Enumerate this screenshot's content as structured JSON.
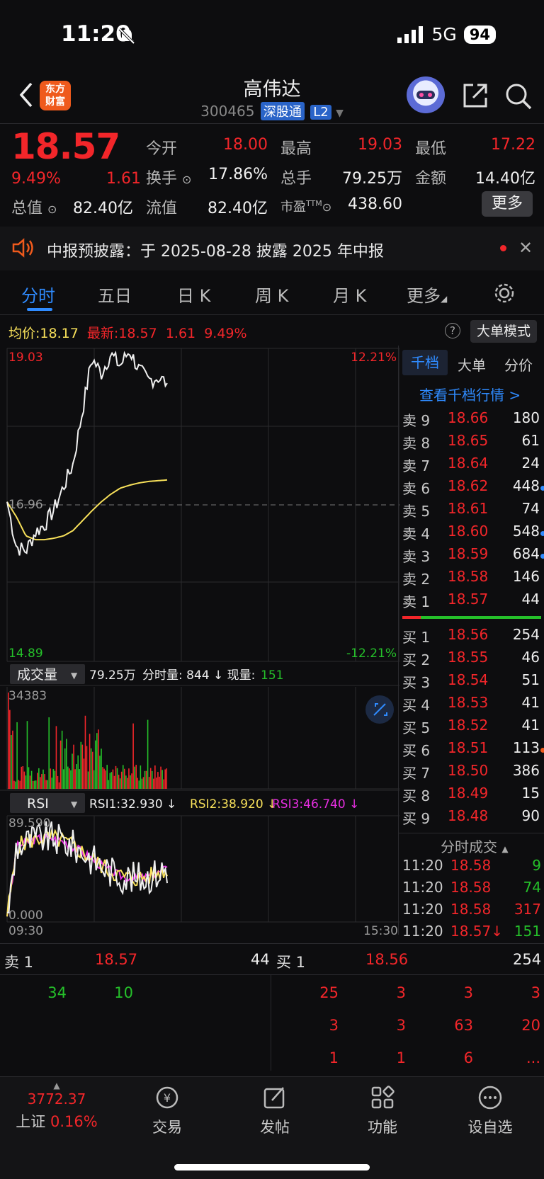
{
  "status": {
    "time": "11:20",
    "signal": "5G",
    "battery": "94"
  },
  "header": {
    "logo_line1": "东方",
    "logo_line2": "财富",
    "name": "高伟达",
    "code": "300465",
    "tag_connect": "深股通",
    "tag_level": "L2"
  },
  "quote": {
    "price": "18.57",
    "pct": "9.49%",
    "change": "1.61",
    "open_label": "今开",
    "open": "18.00",
    "high_label": "最高",
    "high": "19.03",
    "low_label": "最低",
    "low": "17.22",
    "turnover_label": "换手",
    "turnover": "17.86%",
    "total_hands_label": "总手",
    "total_hands": "79.25万",
    "amount_label": "金额",
    "amount": "14.40亿",
    "mktcap_label": "总值",
    "mktcap": "82.40亿",
    "float_label": "流值",
    "float": "82.40亿",
    "pe_label": "市盈",
    "pe_sup": "TTM",
    "pe": "438.60",
    "more": "更多"
  },
  "notice": {
    "text": "中报预披露：于 2025-08-28 披露 2025 年中报"
  },
  "tabs": [
    "分时",
    "五日",
    "日 K",
    "周 K",
    "月 K",
    "更多"
  ],
  "info": {
    "avg_label": "均价:",
    "avg": "18.17",
    "latest_label": "最新:",
    "latest": "18.57",
    "latest_chg": "1.61",
    "latest_pct": "9.49%",
    "big_order": "大单模式"
  },
  "chart_labels": {
    "top_left": "19.03",
    "top_right": "12.21%",
    "mid": "16.96",
    "bottom_left": "14.89",
    "bottom_right": "-12.21%",
    "vol_selector": "成交量",
    "vol_info_total": "79.25万",
    "vol_info_rest": "分时量: 844 ↓ 现量:",
    "vol_info_now": "151",
    "vol_max": "34383",
    "rsi_selector": "RSI",
    "rsi1": "RSI1:32.930 ↓",
    "rsi2": "RSI2:38.920 ↓",
    "rsi3": "RSI3:46.740 ↓",
    "rsi_max": "89.590",
    "rsi_min": "0.000",
    "time_start": "09:30",
    "time_end": "15:30"
  },
  "chart_data": {
    "type": "line",
    "title": "",
    "ylim": [
      14.89,
      19.03
    ],
    "reference": 16.96,
    "series": [
      {
        "name": "均价",
        "values": [
          17.0,
          16.8,
          16.55,
          16.5,
          16.5,
          16.52,
          16.55,
          16.62,
          16.75,
          16.88,
          17.0,
          17.1,
          17.18,
          17.22,
          17.25,
          17.27,
          17.28,
          17.29
        ]
      },
      {
        "name": "最新",
        "values": [
          17.0,
          16.4,
          16.35,
          16.6,
          16.7,
          16.9,
          17.2,
          17.5,
          18.2,
          18.9,
          18.7,
          18.95,
          18.8,
          19.0,
          18.75,
          18.6,
          18.65,
          18.57
        ]
      }
    ],
    "volume": {
      "ymax": 34383
    },
    "rsi": {
      "ylim": [
        0.0,
        89.59
      ],
      "rsi1": 32.93,
      "rsi2": 38.92,
      "rsi3": 46.74
    }
  },
  "orderbook": {
    "tabs": [
      "千档",
      "大单",
      "分价"
    ],
    "view_link": "查看千档行情 >",
    "asks": [
      {
        "label": "卖 9",
        "price": "18.66",
        "vol": "180"
      },
      {
        "label": "卖 8",
        "price": "18.65",
        "vol": "61"
      },
      {
        "label": "卖 7",
        "price": "18.64",
        "vol": "24"
      },
      {
        "label": "卖 6",
        "price": "18.62",
        "vol": "448"
      },
      {
        "label": "卖 5",
        "price": "18.61",
        "vol": "74"
      },
      {
        "label": "卖 4",
        "price": "18.60",
        "vol": "548"
      },
      {
        "label": "卖 3",
        "price": "18.59",
        "vol": "684"
      },
      {
        "label": "卖 2",
        "price": "18.58",
        "vol": "146"
      },
      {
        "label": "卖 1",
        "price": "18.57",
        "vol": "44"
      }
    ],
    "bids": [
      {
        "label": "买 1",
        "price": "18.56",
        "vol": "254"
      },
      {
        "label": "买 2",
        "price": "18.55",
        "vol": "46"
      },
      {
        "label": "买 3",
        "price": "18.54",
        "vol": "51"
      },
      {
        "label": "买 4",
        "price": "18.53",
        "vol": "41"
      },
      {
        "label": "买 5",
        "price": "18.52",
        "vol": "41"
      },
      {
        "label": "买 6",
        "price": "18.51",
        "vol": "113"
      },
      {
        "label": "买 7",
        "price": "18.50",
        "vol": "386"
      },
      {
        "label": "买 8",
        "price": "18.49",
        "vol": "15"
      },
      {
        "label": "买 9",
        "price": "18.48",
        "vol": "90"
      }
    ],
    "trades_title": "分时成交",
    "trades": [
      {
        "time": "11:20",
        "price": "18.58",
        "vol": "9"
      },
      {
        "time": "11:20",
        "price": "18.58",
        "vol": "74"
      },
      {
        "time": "11:20",
        "price": "18.58",
        "vol": "317"
      },
      {
        "time": "11:20",
        "price": "18.57↓",
        "vol": "151"
      }
    ]
  },
  "level1": {
    "ask_label": "卖 1",
    "ask_price": "18.57",
    "ask_vol": "44",
    "bid_label": "买 1",
    "bid_price": "18.56",
    "bid_vol": "254",
    "ask_queue": [
      "34",
      "10"
    ],
    "bid_queue": [
      "25",
      "3",
      "3",
      "3",
      "3",
      "3",
      "63",
      "20",
      "1",
      "1",
      "6",
      "..."
    ]
  },
  "bottom_nav": {
    "index_value": "3772.37",
    "index_name": "上证",
    "index_pct": "0.16%",
    "trade": "交易",
    "post": "发帖",
    "func": "功能",
    "watch": "设自选"
  }
}
